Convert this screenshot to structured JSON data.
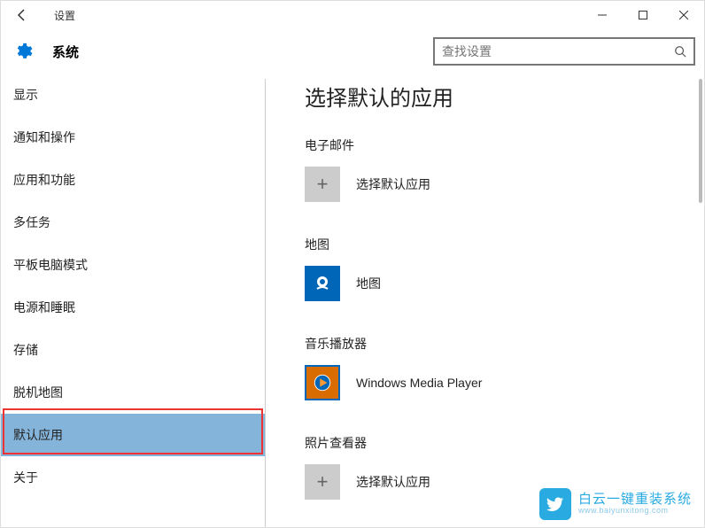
{
  "window": {
    "title": "设置"
  },
  "header": {
    "title": "系统"
  },
  "search": {
    "placeholder": "查找设置"
  },
  "sidebar": {
    "items": [
      {
        "label": "显示"
      },
      {
        "label": "通知和操作"
      },
      {
        "label": "应用和功能"
      },
      {
        "label": "多任务"
      },
      {
        "label": "平板电脑模式"
      },
      {
        "label": "电源和睡眠"
      },
      {
        "label": "存储"
      },
      {
        "label": "脱机地图"
      },
      {
        "label": "默认应用"
      },
      {
        "label": "关于"
      }
    ]
  },
  "content": {
    "title": "选择默认的应用",
    "categories": [
      {
        "label": "电子邮件",
        "app_name": "选择默认应用",
        "tile": "plus"
      },
      {
        "label": "地图",
        "app_name": "地图",
        "tile": "maps"
      },
      {
        "label": "音乐播放器",
        "app_name": "Windows Media Player",
        "tile": "wmp"
      },
      {
        "label": "照片查看器",
        "app_name": "选择默认应用",
        "tile": "plus"
      }
    ]
  },
  "watermark": {
    "main": "白云一键重装系统",
    "sub": "www.baiyunxitong.com"
  }
}
